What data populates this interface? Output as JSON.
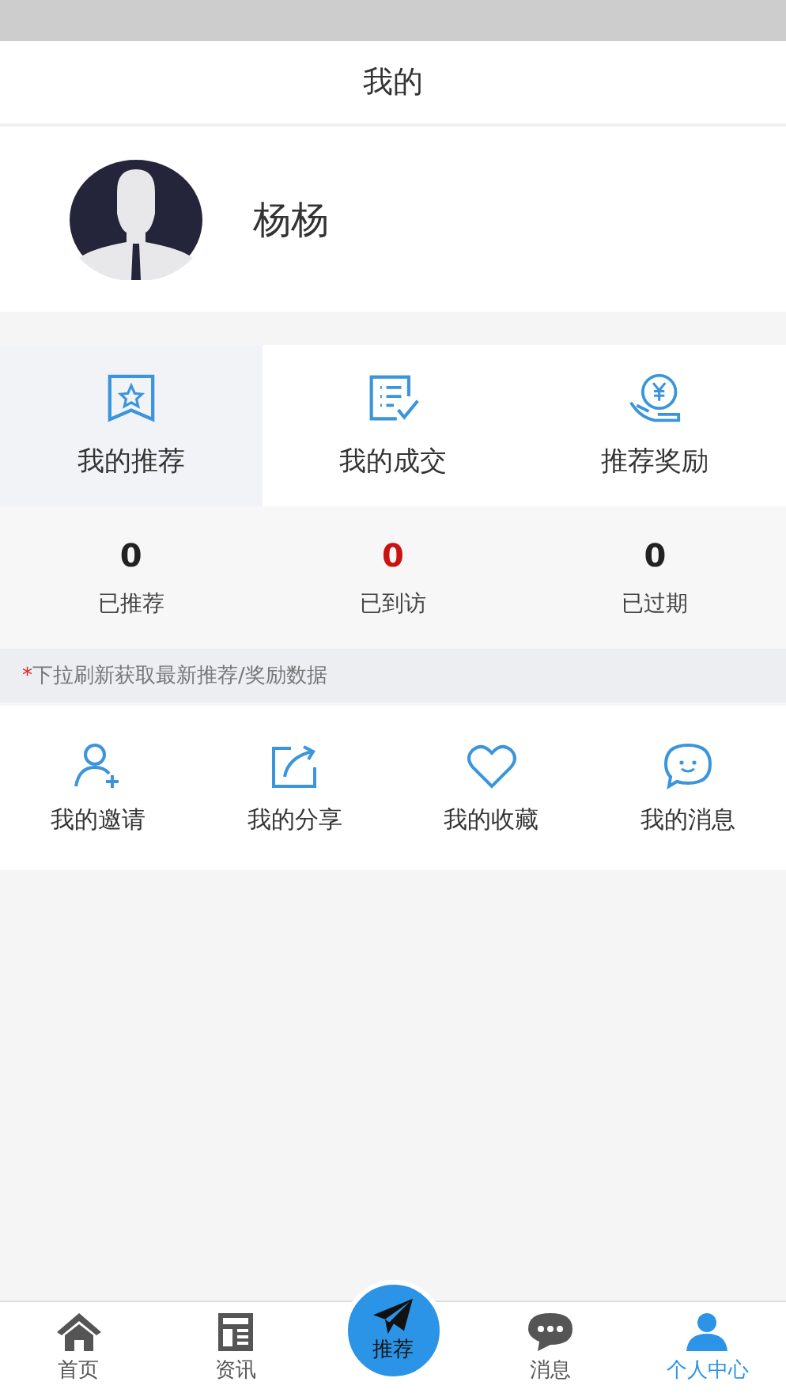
{
  "header": {
    "title": "我的"
  },
  "profile": {
    "name": "杨杨"
  },
  "menu": [
    {
      "label": "我的推荐",
      "selected": true
    },
    {
      "label": "我的成交",
      "selected": false
    },
    {
      "label": "推荐奖励",
      "selected": false
    }
  ],
  "stats": [
    {
      "value": "0",
      "label": "已推荐",
      "color": "#222222"
    },
    {
      "value": "0",
      "label": "已到访",
      "color": "#cc1111"
    },
    {
      "value": "0",
      "label": "已过期",
      "color": "#222222"
    }
  ],
  "notice": {
    "mark": "*",
    "text": "下拉刷新获取最新推荐/奖励数据"
  },
  "shortcuts": [
    {
      "label": "我的邀请"
    },
    {
      "label": "我的分享"
    },
    {
      "label": "我的收藏"
    },
    {
      "label": "我的消息"
    }
  ],
  "tabbar": [
    {
      "label": "首页",
      "kind": "plain",
      "selected": false
    },
    {
      "label": "资讯",
      "kind": "plain",
      "selected": false
    },
    {
      "label": "推荐",
      "kind": "center",
      "selected": false
    },
    {
      "label": "消息",
      "kind": "plain",
      "selected": false
    },
    {
      "label": "个人中心",
      "kind": "plain",
      "selected": true
    }
  ]
}
